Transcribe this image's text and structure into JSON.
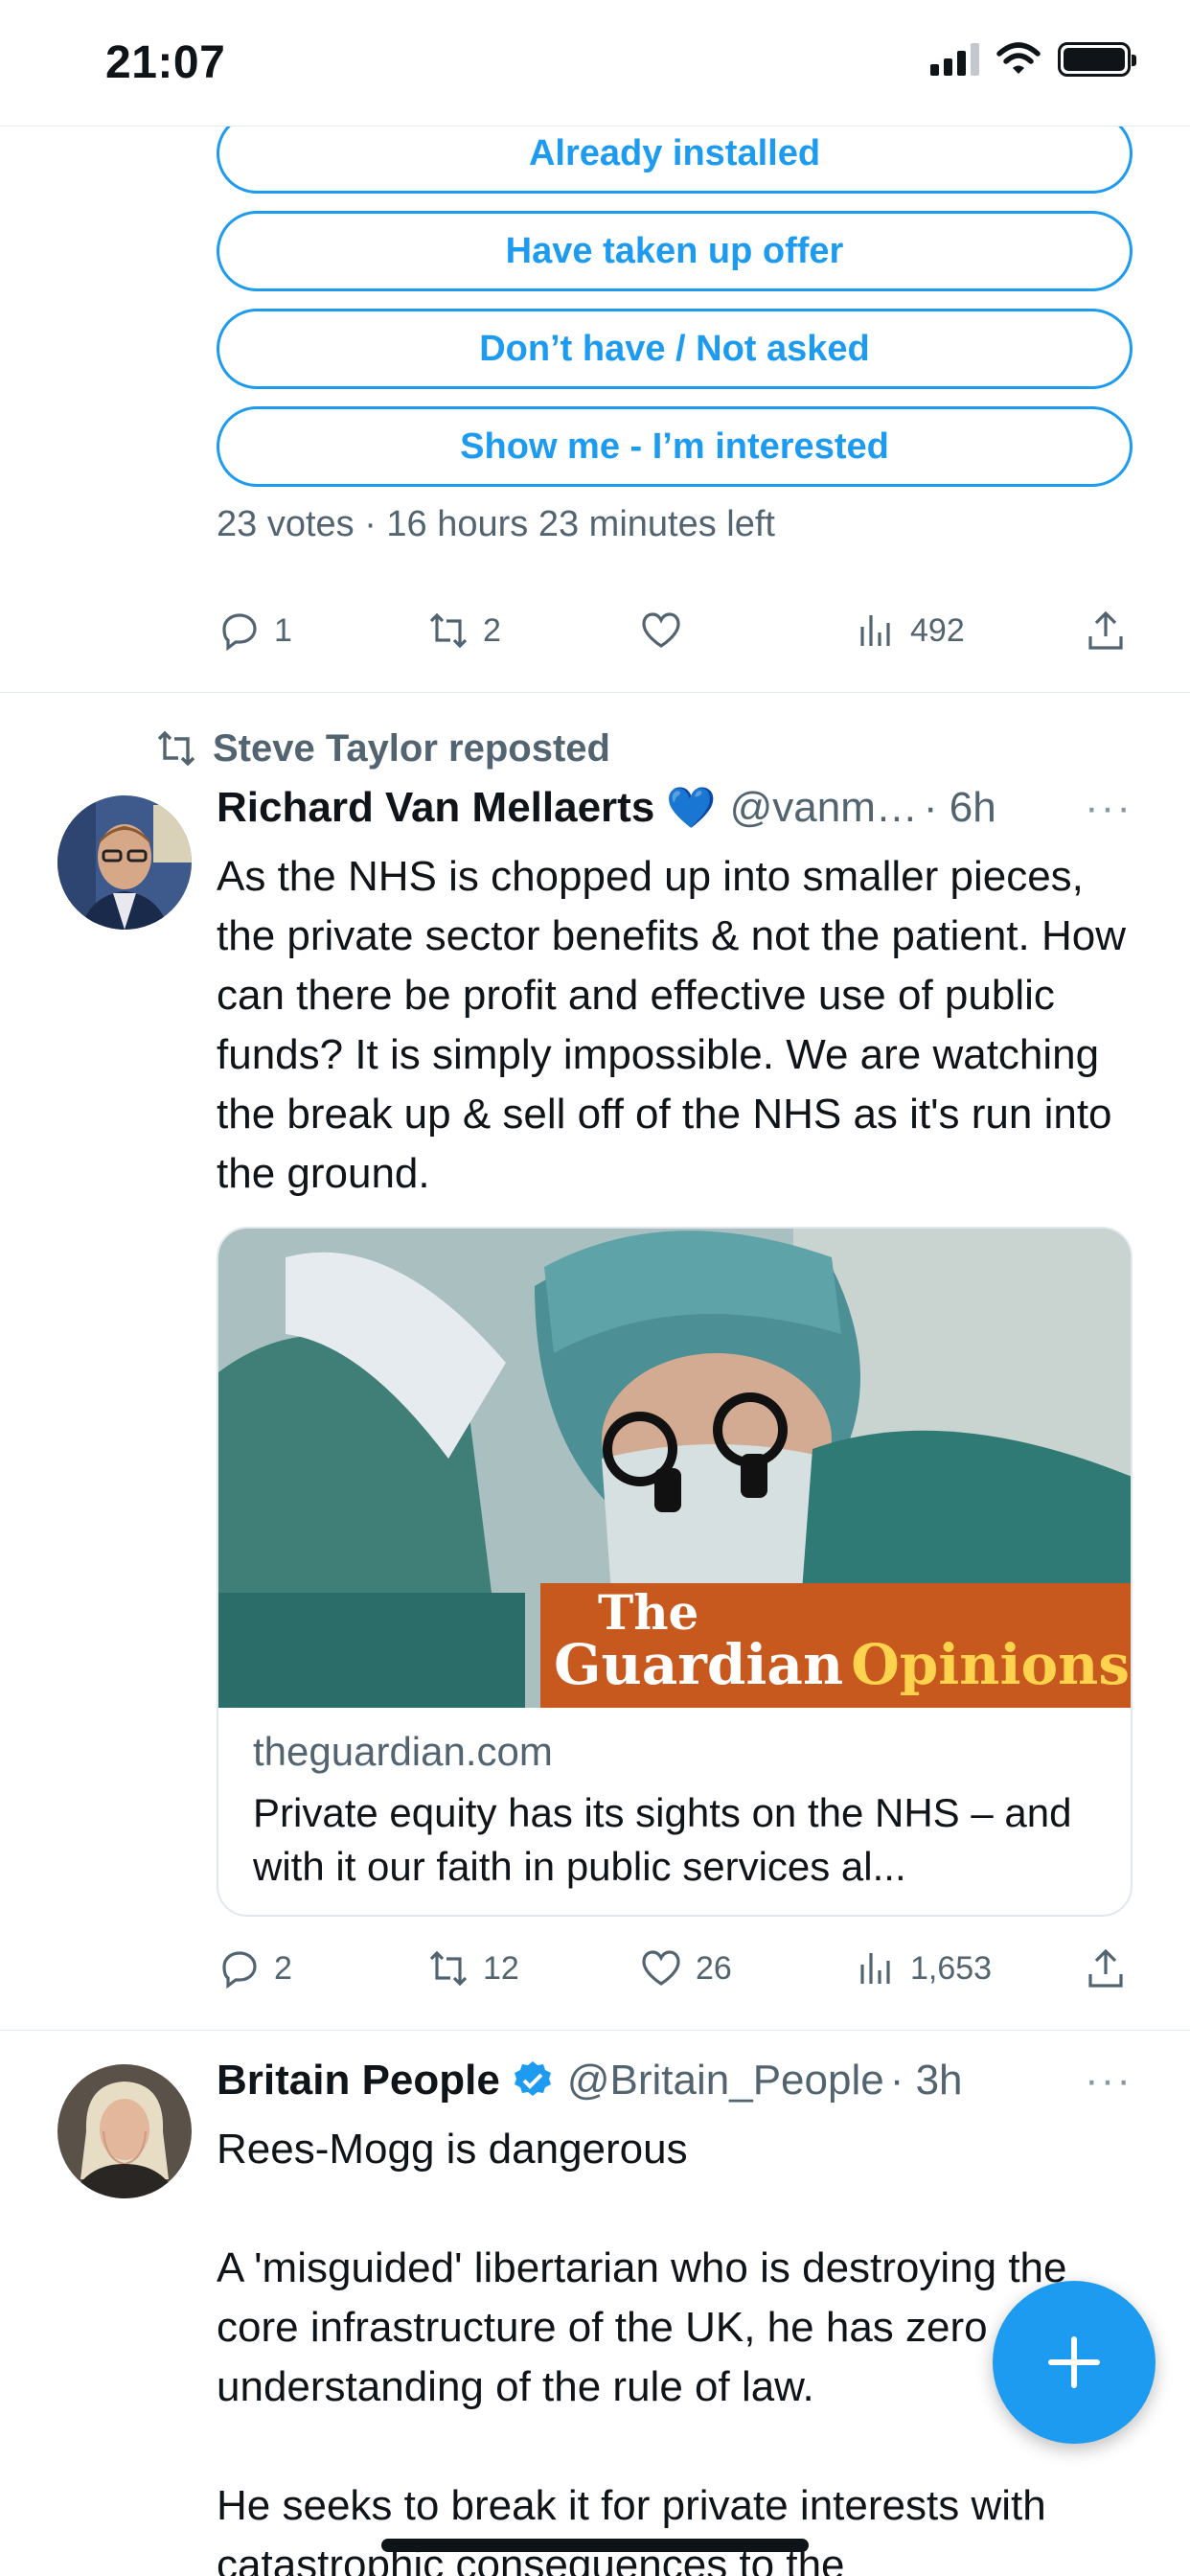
{
  "status_bar": {
    "time": "21:07"
  },
  "poll": {
    "options": [
      "Already installed",
      "Have taken up offer",
      "Don’t have / Not asked",
      "Show me - I’m interested"
    ],
    "meta": "23 votes · 16 hours 23 minutes left",
    "stats": {
      "replies": "1",
      "reposts": "2",
      "likes": "",
      "views": "492"
    }
  },
  "tweet1": {
    "repost_label": "Steve Taylor reposted",
    "name": "Richard Van Mellaerts",
    "emoji": "💙",
    "handle": "@vanm…",
    "time": "· 6h",
    "more": "···",
    "text": "As the NHS is chopped up into smaller pieces, the private sector benefits & not the patient. How can there be profit and effective use of public funds? It is simply impossible. We are watching the break up & sell off of the NHS as it's run into the ground.",
    "card": {
      "brand_line1": "The",
      "brand_line2": "Guardian",
      "brand_line3": "Opinions",
      "domain": "theguardian.com",
      "title": "Private equity has its sights on the NHS – and with it our faith in public services al..."
    },
    "stats": {
      "replies": "2",
      "reposts": "12",
      "likes": "26",
      "views": "1,653"
    }
  },
  "tweet2": {
    "name": "Britain People",
    "handle": "@Britain_People",
    "time": "· 3h",
    "more": "···",
    "para1": "Rees-Mogg is dangerous",
    "para2": "A 'misguided' libertarian who is destroying the core infrastructure of the UK, he has zero understanding of the rule of law.",
    "para3": "He seeks to break it for private interests with catastrophic consequences to the"
  },
  "colors": {
    "accent": "#1d9bf0",
    "muted": "#536471",
    "guardian_orange": "#c8591e",
    "guardian_yellow": "#ffd34d"
  },
  "icons": [
    "reply-icon",
    "repost-icon",
    "like-icon",
    "views-icon",
    "share-icon",
    "verified-icon",
    "compose-plus-icon"
  ]
}
